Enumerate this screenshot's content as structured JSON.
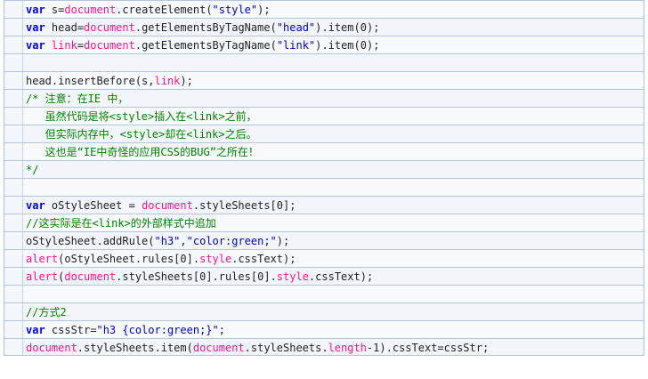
{
  "lines": [
    [
      {
        "t": "var",
        "c": "kw"
      },
      {
        "t": " s",
        "c": "plain"
      },
      {
        "t": "=",
        "c": "plain"
      },
      {
        "t": "document",
        "c": "obj"
      },
      {
        "t": ".createElement(",
        "c": "plain"
      },
      {
        "t": "\"style\"",
        "c": "str"
      },
      {
        "t": ");",
        "c": "plain"
      }
    ],
    [
      {
        "t": "var",
        "c": "kw"
      },
      {
        "t": " head",
        "c": "plain"
      },
      {
        "t": "=",
        "c": "plain"
      },
      {
        "t": "document",
        "c": "obj"
      },
      {
        "t": ".getElementsByTagName(",
        "c": "plain"
      },
      {
        "t": "\"head\"",
        "c": "str"
      },
      {
        "t": ").item(",
        "c": "plain"
      },
      {
        "t": "0",
        "c": "num"
      },
      {
        "t": ");",
        "c": "plain"
      }
    ],
    [
      {
        "t": "var",
        "c": "kw"
      },
      {
        "t": " ",
        "c": "plain"
      },
      {
        "t": "link",
        "c": "obj"
      },
      {
        "t": "=",
        "c": "plain"
      },
      {
        "t": "document",
        "c": "obj"
      },
      {
        "t": ".getElementsByTagName(",
        "c": "plain"
      },
      {
        "t": "\"link\"",
        "c": "str"
      },
      {
        "t": ").item(",
        "c": "plain"
      },
      {
        "t": "0",
        "c": "num"
      },
      {
        "t": ");",
        "c": "plain"
      }
    ],
    [],
    [
      {
        "t": "head.insertBefore(s,",
        "c": "plain"
      },
      {
        "t": "link",
        "c": "obj"
      },
      {
        "t": ");",
        "c": "plain"
      }
    ],
    [
      {
        "t": "/* 注意：在IE 中，",
        "c": "cmt"
      }
    ],
    [
      {
        "t": "   虽然代码是将<style>插入在<link>之前，",
        "c": "cmt"
      }
    ],
    [
      {
        "t": "   但实际内存中，<style>却在<link>之后。",
        "c": "cmt"
      }
    ],
    [
      {
        "t": "   这也是“IE中奇怪的应用CSS的BUG”之所在！",
        "c": "cmt"
      }
    ],
    [
      {
        "t": "*/",
        "c": "cmt"
      }
    ],
    [],
    [
      {
        "t": "var",
        "c": "kw"
      },
      {
        "t": " oStyleSheet = ",
        "c": "plain"
      },
      {
        "t": "document",
        "c": "obj"
      },
      {
        "t": ".styleSheets[",
        "c": "plain"
      },
      {
        "t": "0",
        "c": "num"
      },
      {
        "t": "];",
        "c": "plain"
      }
    ],
    [
      {
        "t": "//这实际是在<link>的外部样式中追加",
        "c": "cmt"
      }
    ],
    [
      {
        "t": "oStyleSheet.addRule(",
        "c": "plain"
      },
      {
        "t": "\"h3\"",
        "c": "str"
      },
      {
        "t": ",",
        "c": "plain"
      },
      {
        "t": "\"color:green;\"",
        "c": "str"
      },
      {
        "t": ");",
        "c": "plain"
      }
    ],
    [
      {
        "t": "alert",
        "c": "obj"
      },
      {
        "t": "(oStyleSheet.rules[",
        "c": "plain"
      },
      {
        "t": "0",
        "c": "num"
      },
      {
        "t": "].",
        "c": "plain"
      },
      {
        "t": "style",
        "c": "obj"
      },
      {
        "t": ".cssText);",
        "c": "plain"
      }
    ],
    [
      {
        "t": "alert",
        "c": "obj"
      },
      {
        "t": "(",
        "c": "plain"
      },
      {
        "t": "document",
        "c": "obj"
      },
      {
        "t": ".styleSheets[",
        "c": "plain"
      },
      {
        "t": "0",
        "c": "num"
      },
      {
        "t": "].rules[",
        "c": "plain"
      },
      {
        "t": "0",
        "c": "num"
      },
      {
        "t": "].",
        "c": "plain"
      },
      {
        "t": "style",
        "c": "obj"
      },
      {
        "t": ".cssText);",
        "c": "plain"
      }
    ],
    [],
    [
      {
        "t": "//方式2",
        "c": "cmt"
      }
    ],
    [
      {
        "t": "var",
        "c": "kw"
      },
      {
        "t": " cssStr=",
        "c": "plain"
      },
      {
        "t": "\"h3 {color:green;}\"",
        "c": "str"
      },
      {
        "t": ";",
        "c": "plain"
      }
    ],
    [
      {
        "t": "document",
        "c": "obj"
      },
      {
        "t": ".styleSheets.item(",
        "c": "plain"
      },
      {
        "t": "document",
        "c": "obj"
      },
      {
        "t": ".styleSheets.",
        "c": "plain"
      },
      {
        "t": "length",
        "c": "obj"
      },
      {
        "t": "-",
        "c": "plain"
      },
      {
        "t": "1",
        "c": "num"
      },
      {
        "t": ").cssText=cssStr;",
        "c": "plain"
      }
    ]
  ],
  "colors": {
    "keyword": "#0000ff",
    "object": "#ff1493",
    "string": "#0000cc",
    "comment": "#008200",
    "plain": "#222222",
    "row_border": "#b3c6da",
    "row_bg": "#f7f9fc"
  }
}
